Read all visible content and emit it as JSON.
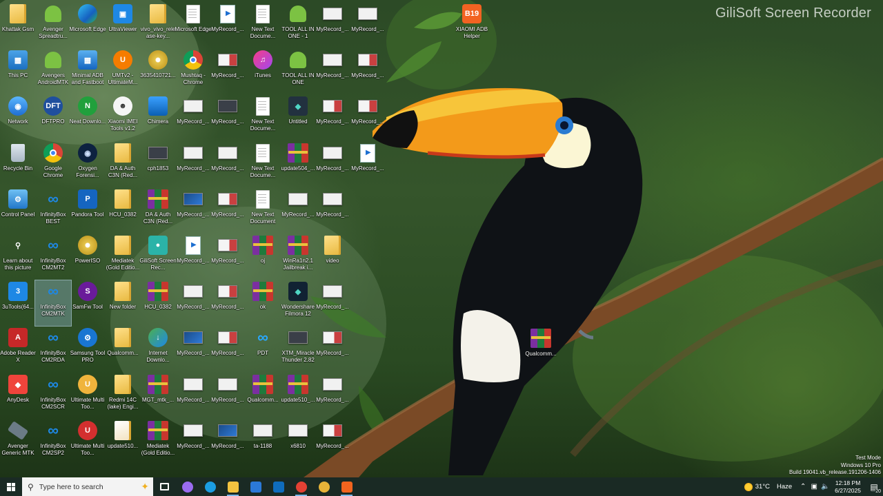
{
  "watermark": "GiliSoft Screen Recorder",
  "desktop_icons": [
    {
      "col": 0,
      "row": 0,
      "label": "Khattak Gsm",
      "kind": "folder"
    },
    {
      "col": 0,
      "row": 1,
      "label": "This PC",
      "kind": "pc"
    },
    {
      "col": 0,
      "row": 2,
      "label": "Network",
      "kind": "network"
    },
    {
      "col": 0,
      "row": 3,
      "label": "Recycle Bin",
      "kind": "bin"
    },
    {
      "col": 0,
      "row": 4,
      "label": "Control Panel",
      "kind": "control"
    },
    {
      "col": 0,
      "row": 5,
      "label": "Learn about this picture",
      "kind": "learn"
    },
    {
      "col": 0,
      "row": 6,
      "label": "3uTools(64...",
      "kind": "tools3u"
    },
    {
      "col": 0,
      "row": 7,
      "label": "Adobe Reader X",
      "kind": "adobe"
    },
    {
      "col": 0,
      "row": 8,
      "label": "AnyDesk",
      "kind": "anydesk"
    },
    {
      "col": 0,
      "row": 9,
      "label": "Avenger Generic MTK",
      "kind": "avenger"
    },
    {
      "col": 1,
      "row": 0,
      "label": "Avenger Spreadtru...",
      "kind": "android"
    },
    {
      "col": 1,
      "row": 1,
      "label": "Avengers AndroidMTK",
      "kind": "android"
    },
    {
      "col": 1,
      "row": 2,
      "label": "DFTPRO",
      "kind": "dft"
    },
    {
      "col": 1,
      "row": 3,
      "label": "Google Chrome",
      "kind": "chrome"
    },
    {
      "col": 1,
      "row": 4,
      "label": "InfinityBox BEST",
      "kind": "infinity"
    },
    {
      "col": 1,
      "row": 5,
      "label": "InfinityBox CM2MT2",
      "kind": "infinity"
    },
    {
      "col": 1,
      "row": 6,
      "label": "InfinityBox CM2MTK",
      "kind": "infinity",
      "selected": true
    },
    {
      "col": 1,
      "row": 7,
      "label": "InfinityBox CM2RDA",
      "kind": "infinity"
    },
    {
      "col": 1,
      "row": 8,
      "label": "InfinityBox CM2SCR",
      "kind": "infinity"
    },
    {
      "col": 1,
      "row": 9,
      "label": "InfinityBox CM2SP2",
      "kind": "infinity"
    },
    {
      "col": 2,
      "row": 0,
      "label": "Microsoft Edge",
      "kind": "edge"
    },
    {
      "col": 2,
      "row": 1,
      "label": "Minimal ADB and Fastboot",
      "kind": "adb"
    },
    {
      "col": 2,
      "row": 2,
      "label": "Neat Downlo...",
      "kind": "neat"
    },
    {
      "col": 2,
      "row": 3,
      "label": "Oxygen Forensi...",
      "kind": "oxygen"
    },
    {
      "col": 2,
      "row": 4,
      "label": "Pandora Tool",
      "kind": "pandora"
    },
    {
      "col": 2,
      "row": 5,
      "label": "PowerISO",
      "kind": "disc"
    },
    {
      "col": 2,
      "row": 6,
      "label": "SamFw Tool",
      "kind": "samfw"
    },
    {
      "col": 2,
      "row": 7,
      "label": "Samsung Tool PRO",
      "kind": "samsung"
    },
    {
      "col": 2,
      "row": 8,
      "label": "Ultimate Multi Too...",
      "kind": "ultimate"
    },
    {
      "col": 2,
      "row": 9,
      "label": "Ultimate Multi Too...",
      "kind": "ultimate2"
    },
    {
      "col": 3,
      "row": 0,
      "label": "UltraViewer",
      "kind": "ultraviewer"
    },
    {
      "col": 3,
      "row": 1,
      "label": "UMTv2 - UltimateM...",
      "kind": "umt"
    },
    {
      "col": 3,
      "row": 2,
      "label": "Xiaomi IMEI Tools v1.2",
      "kind": "xiaomi"
    },
    {
      "col": 3,
      "row": 3,
      "label": "DA & Auth C3N (Red...",
      "kind": "folder"
    },
    {
      "col": 3,
      "row": 4,
      "label": "HCU_0382",
      "kind": "folder"
    },
    {
      "col": 3,
      "row": 5,
      "label": "Mediatek (Gold Editio...",
      "kind": "folder"
    },
    {
      "col": 3,
      "row": 6,
      "label": "New folder",
      "kind": "folder"
    },
    {
      "col": 3,
      "row": 7,
      "label": "Qualcomm...",
      "kind": "folder"
    },
    {
      "col": 3,
      "row": 8,
      "label": "Redmi 14C (lake) Engi...",
      "kind": "folder"
    },
    {
      "col": 3,
      "row": 9,
      "label": "update510...",
      "kind": "folder2"
    },
    {
      "col": 4,
      "row": 0,
      "label": "vivo_vivo_release-key...",
      "kind": "folder"
    },
    {
      "col": 4,
      "row": 1,
      "label": "3635410721...",
      "kind": "disc"
    },
    {
      "col": 4,
      "row": 2,
      "label": "Chimera",
      "kind": "chimera"
    },
    {
      "col": 4,
      "row": 3,
      "label": "cph1853",
      "kind": "thumbdark"
    },
    {
      "col": 4,
      "row": 4,
      "label": "DA & Auth C3N (Red...",
      "kind": "rar"
    },
    {
      "col": 4,
      "row": 5,
      "label": "GiliSoft Screen Rec...",
      "kind": "gilisoft"
    },
    {
      "col": 4,
      "row": 6,
      "label": "HCU_0382",
      "kind": "rar"
    },
    {
      "col": 4,
      "row": 7,
      "label": "Internet Downlo...",
      "kind": "idm"
    },
    {
      "col": 4,
      "row": 8,
      "label": "MGT_mtk_...",
      "kind": "rar"
    },
    {
      "col": 4,
      "row": 9,
      "label": "Mediatek (Gold Editio...",
      "kind": "rar"
    },
    {
      "col": 5,
      "row": 0,
      "label": "Microsoft Edge",
      "kind": "doc"
    },
    {
      "col": 5,
      "row": 1,
      "label": "Mushtaq - Chrome",
      "kind": "chrome"
    },
    {
      "col": 5,
      "row": 2,
      "label": "MyRecord_...",
      "kind": "thumb"
    },
    {
      "col": 5,
      "row": 3,
      "label": "MyRecord_...",
      "kind": "thumb"
    },
    {
      "col": 5,
      "row": 4,
      "label": "MyRecord_...",
      "kind": "thumbblue"
    },
    {
      "col": 5,
      "row": 5,
      "label": "MyRecord_...",
      "kind": "video"
    },
    {
      "col": 5,
      "row": 6,
      "label": "MyRecord_...",
      "kind": "thumb"
    },
    {
      "col": 5,
      "row": 7,
      "label": "MyRecord_...",
      "kind": "thumbblue"
    },
    {
      "col": 5,
      "row": 8,
      "label": "MyRecord_...",
      "kind": "thumb"
    },
    {
      "col": 5,
      "row": 9,
      "label": "MyRecord_...",
      "kind": "thumb"
    },
    {
      "col": 6,
      "row": 0,
      "label": "MyRecord_...",
      "kind": "video"
    },
    {
      "col": 6,
      "row": 1,
      "label": "MyRecord_...",
      "kind": "thumbred"
    },
    {
      "col": 6,
      "row": 2,
      "label": "MyRecord_...",
      "kind": "thumbdark"
    },
    {
      "col": 6,
      "row": 3,
      "label": "MyRecord_...",
      "kind": "thumb"
    },
    {
      "col": 6,
      "row": 4,
      "label": "MyRecord_...",
      "kind": "thumbred"
    },
    {
      "col": 6,
      "row": 5,
      "label": "MyRecord_...",
      "kind": "thumbred"
    },
    {
      "col": 6,
      "row": 6,
      "label": "MyRecord_...",
      "kind": "thumbred"
    },
    {
      "col": 6,
      "row": 7,
      "label": "MyRecord_...",
      "kind": "thumbred"
    },
    {
      "col": 6,
      "row": 8,
      "label": "MyRecord_...",
      "kind": "thumb"
    },
    {
      "col": 6,
      "row": 9,
      "label": "MyRecord_...",
      "kind": "thumbblue"
    },
    {
      "col": 7,
      "row": 0,
      "label": "New Text Docume...",
      "kind": "doc"
    },
    {
      "col": 7,
      "row": 1,
      "label": "iTunes",
      "kind": "itunes"
    },
    {
      "col": 7,
      "row": 2,
      "label": "New Text Docume...",
      "kind": "doc"
    },
    {
      "col": 7,
      "row": 3,
      "label": "New Text Docume...",
      "kind": "doc"
    },
    {
      "col": 7,
      "row": 4,
      "label": "New Text Document",
      "kind": "doc"
    },
    {
      "col": 7,
      "row": 5,
      "label": "oj",
      "kind": "rar"
    },
    {
      "col": 7,
      "row": 6,
      "label": "ok",
      "kind": "rar"
    },
    {
      "col": 7,
      "row": 7,
      "label": "PDT",
      "kind": "pdt"
    },
    {
      "col": 7,
      "row": 8,
      "label": "Qualcomm...",
      "kind": "rar"
    },
    {
      "col": 7,
      "row": 9,
      "label": "ta-1188",
      "kind": "thumb"
    },
    {
      "col": 8,
      "row": 0,
      "label": "TOOL ALL IN ONE - 1",
      "kind": "android"
    },
    {
      "col": 8,
      "row": 1,
      "label": "TOOL ALL IN ONE",
      "kind": "android"
    },
    {
      "col": 8,
      "row": 2,
      "label": "Untitled",
      "kind": "untitled"
    },
    {
      "col": 8,
      "row": 3,
      "label": "update504_...",
      "kind": "rar"
    },
    {
      "col": 8,
      "row": 4,
      "label": "MyRecord_...",
      "kind": "thumb"
    },
    {
      "col": 8,
      "row": 5,
      "label": "WinRa1n2.1 Jailbreak i...",
      "kind": "rar"
    },
    {
      "col": 8,
      "row": 6,
      "label": "Wondershare Filmora 12",
      "kind": "filmora"
    },
    {
      "col": 8,
      "row": 7,
      "label": "XTM_Miracle Thunder 2.82",
      "kind": "thumbdark"
    },
    {
      "col": 8,
      "row": 8,
      "label": "update510_...",
      "kind": "rar"
    },
    {
      "col": 8,
      "row": 9,
      "label": "x6810",
      "kind": "thumb"
    },
    {
      "col": 9,
      "row": 0,
      "label": "MyRecord_...",
      "kind": "thumb"
    },
    {
      "col": 9,
      "row": 1,
      "label": "MyRecord_...",
      "kind": "thumb"
    },
    {
      "col": 9,
      "row": 2,
      "label": "MyRecord_...",
      "kind": "thumbred"
    },
    {
      "col": 9,
      "row": 3,
      "label": "MyRecord_...",
      "kind": "thumb"
    },
    {
      "col": 9,
      "row": 4,
      "label": "MyRecord_...",
      "kind": "thumb"
    },
    {
      "col": 9,
      "row": 5,
      "label": "video",
      "kind": "folder"
    },
    {
      "col": 9,
      "row": 6,
      "label": "MyRecord_...",
      "kind": "thumb"
    },
    {
      "col": 9,
      "row": 7,
      "label": "MyRecord_...",
      "kind": "thumbred"
    },
    {
      "col": 9,
      "row": 8,
      "label": "MyRecord_...",
      "kind": "thumb"
    },
    {
      "col": 9,
      "row": 9,
      "label": "MyRecord_...",
      "kind": "thumbred"
    },
    {
      "col": 10,
      "row": 0,
      "label": "MyRecord_...",
      "kind": "thumb"
    },
    {
      "col": 10,
      "row": 1,
      "label": "MyRecord_...",
      "kind": "thumbred"
    },
    {
      "col": 10,
      "row": 2,
      "label": "MyRecord_...",
      "kind": "thumbred"
    },
    {
      "col": 10,
      "row": 3,
      "label": "MyRecord_...",
      "kind": "video"
    }
  ],
  "extra_icons": [
    {
      "id": "xiaomi-adb",
      "label": "XIAOMI ADB Helper",
      "kind": "b19"
    },
    {
      "id": "qualcomm-right",
      "label": "Qualcomm...",
      "kind": "rar"
    }
  ],
  "system_info": {
    "line1": "Test Mode",
    "line2": "Windows 10 Pro",
    "line3": "Build 19041.vb_release.191206-1406"
  },
  "taskbar": {
    "search_placeholder": "Type here to search",
    "pinned": [
      {
        "name": "task-view",
        "color": "#ffffff"
      },
      {
        "name": "copilot",
        "color": "#9b6cf0"
      },
      {
        "name": "edge",
        "color": "#1b9de2"
      },
      {
        "name": "file-explorer",
        "color": "#f3c340",
        "active": true
      },
      {
        "name": "store",
        "color": "#2b79d8"
      },
      {
        "name": "outlook",
        "color": "#0f6cbd"
      },
      {
        "name": "chrome",
        "color": "#e44134",
        "active": true
      },
      {
        "name": "poweriso",
        "color": "#e7b338"
      },
      {
        "name": "gilisoft",
        "color": "#f1641e",
        "active": true
      }
    ],
    "weather_temp": "31°C",
    "weather_desc": "Haze",
    "time": "12:18 PM",
    "date": "6/27/2025",
    "notification_count": "20"
  }
}
